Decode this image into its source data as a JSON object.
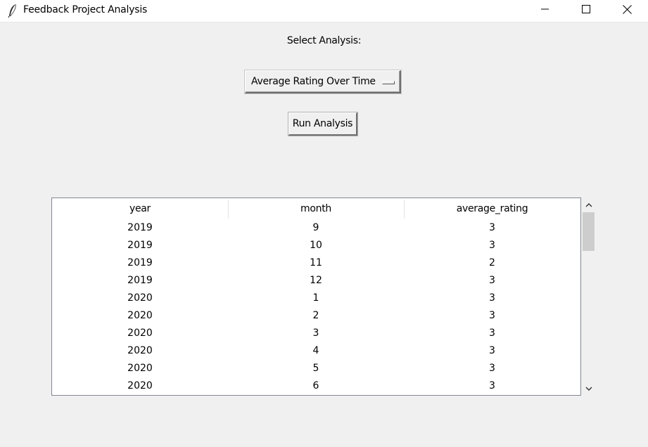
{
  "window": {
    "title": "Feedback Project Analysis",
    "icon": "feather-icon",
    "controls": [
      "minimize-icon",
      "maximize-icon",
      "close-icon"
    ]
  },
  "form": {
    "select_label": "Select Analysis:",
    "analysis_selected": "Average Rating Over Time",
    "run_label": "Run Analysis"
  },
  "table": {
    "columns": [
      "year",
      "month",
      "average_rating"
    ],
    "rows": [
      [
        "2019",
        "9",
        "3"
      ],
      [
        "2019",
        "10",
        "3"
      ],
      [
        "2019",
        "11",
        "2"
      ],
      [
        "2019",
        "12",
        "3"
      ],
      [
        "2020",
        "1",
        "3"
      ],
      [
        "2020",
        "2",
        "3"
      ],
      [
        "2020",
        "3",
        "3"
      ],
      [
        "2020",
        "4",
        "3"
      ],
      [
        "2020",
        "5",
        "3"
      ],
      [
        "2020",
        "6",
        "3"
      ]
    ]
  },
  "scrollbar": {
    "up_icon": "chevron-up-icon",
    "down_icon": "chevron-down-icon",
    "position": 0
  }
}
